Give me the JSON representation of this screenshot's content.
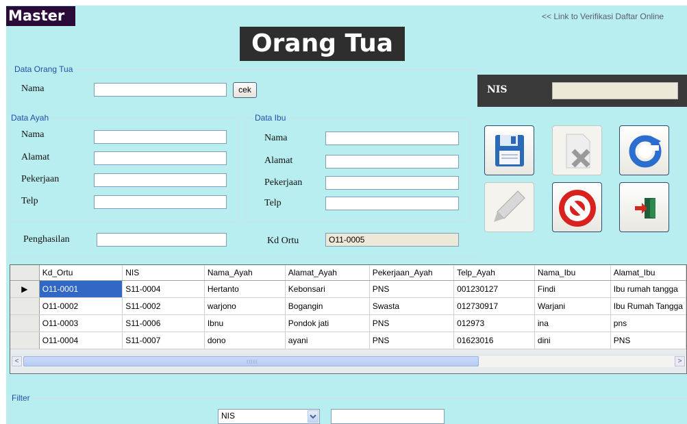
{
  "header": {
    "master": "Master",
    "link": "<< Link to Verifikasi Daftar Online",
    "title": "Orang Tua"
  },
  "ortu_group": {
    "legend": "Data Orang Tua",
    "nama_label": "Nama",
    "nama_value": "",
    "cek_button": "cek"
  },
  "ayah_group": {
    "legend": "Data Ayah",
    "nama_label": "Nama",
    "alamat_label": "Alamat",
    "pekerjaan_label": "Pekerjaan",
    "telp_label": "Telp"
  },
  "ibu_group": {
    "legend": "Data Ibu",
    "nama_label": "Nama",
    "alamat_label": "Alamat",
    "pekerjaan_label": "Pekerjaan",
    "telp_label": "Telp"
  },
  "penghasilan": {
    "label": "Penghasilan",
    "value": ""
  },
  "kd_ortu": {
    "label": "Kd Ortu",
    "value": "O11-0005"
  },
  "nis_panel": {
    "label": "NIS",
    "value": ""
  },
  "toolbar": {
    "icons": [
      "save-icon",
      "delete-icon",
      "refresh-icon",
      "edit-icon",
      "cancel-icon",
      "exit-icon"
    ],
    "disabled": [
      "delete",
      "edit"
    ]
  },
  "grid": {
    "columns": [
      "Kd_Ortu",
      "NIS",
      "Nama_Ayah",
      "Alamat_Ayah",
      "Pekerjaan_Ayah",
      "Telp_Ayah",
      "Nama_Ibu",
      "Alamat_Ibu"
    ],
    "rows": [
      [
        "O11-0001",
        "S11-0004",
        "Hertanto",
        "Kebonsari",
        "PNS",
        "001230127",
        "Findi",
        "Ibu rumah tangga"
      ],
      [
        "O11-0002",
        "S11-0002",
        "warjono",
        "Bogangin",
        "Swasta",
        "012730917",
        "Warjani",
        "Ibu Rumah Tangga"
      ],
      [
        "O11-0003",
        "S11-0006",
        "Ibnu",
        "Pondok jati",
        "PNS",
        "012973",
        "ina",
        "pns"
      ],
      [
        "O11-0004",
        "S11-0007",
        "dono",
        "ayani",
        "PNS",
        "01623016",
        "dini",
        "PNS"
      ]
    ],
    "row_indicator": "▶",
    "scroll_left": "<",
    "scroll_right": ">",
    "scroll_grip": "IIIII"
  },
  "filter": {
    "legend": "Filter",
    "field_selected": "NIS",
    "value": ""
  },
  "colors": {
    "background": "#b9eef0",
    "selected_row": "#3168c6",
    "legend": "#1f4ea8"
  }
}
